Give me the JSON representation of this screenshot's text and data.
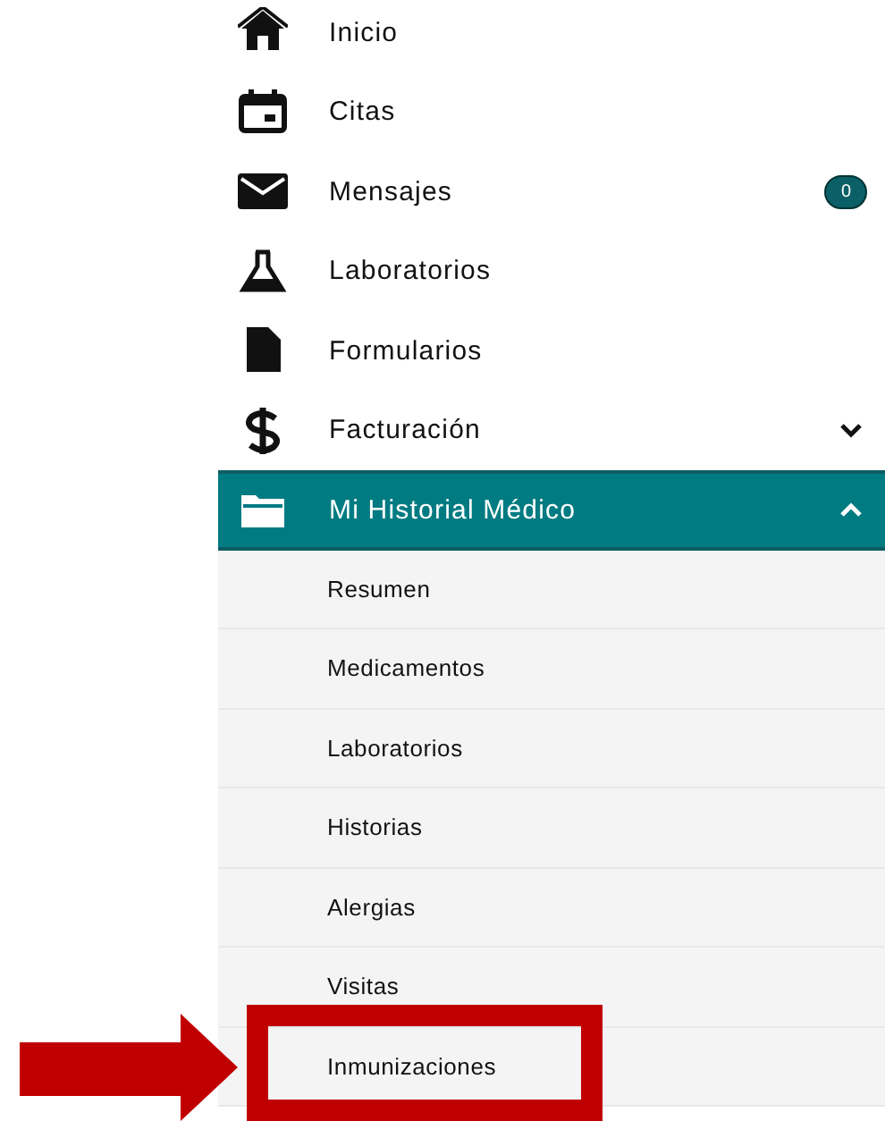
{
  "menu": [
    {
      "label": "Inicio",
      "selected": false
    },
    {
      "label": "Citas",
      "selected": false
    },
    {
      "label": "Mensajes",
      "selected": false,
      "badge": "0"
    },
    {
      "label": "Laboratorios",
      "selected": false
    },
    {
      "label": "Formularios",
      "selected": false
    },
    {
      "label": "Facturación",
      "selected": false,
      "expanded": false
    },
    {
      "label": "Mi Historial Médico",
      "selected": true,
      "expanded": true,
      "children": [
        {
          "label": "Resumen",
          "selected": false
        },
        {
          "label": "Medicamentos",
          "selected": false
        },
        {
          "label": "Laboratorios",
          "selected": false
        },
        {
          "label": "Historias",
          "selected": false
        },
        {
          "label": "Alergias",
          "selected": false
        },
        {
          "label": "Visitas",
          "selected": false
        },
        {
          "label": "Inmunizaciones",
          "selected": false
        }
      ]
    }
  ],
  "annotations": {
    "arrow": true,
    "highlight_frame": true
  }
}
